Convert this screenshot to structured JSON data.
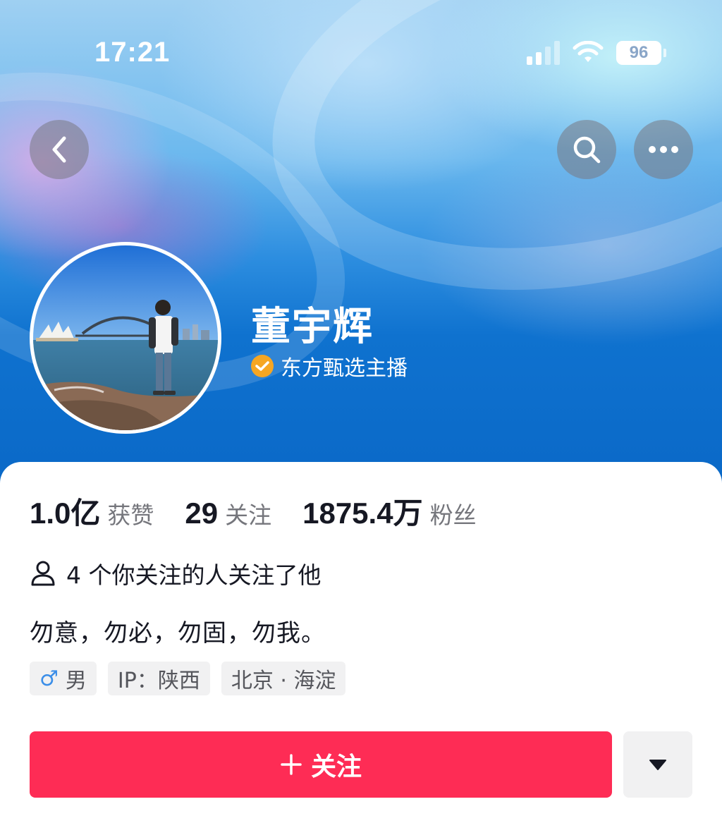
{
  "status_bar": {
    "time": "17:21",
    "battery": "96",
    "icons": [
      "signal-icon",
      "wifi-icon",
      "battery-icon"
    ]
  },
  "nav": {
    "icons": [
      "back-icon",
      "search-icon",
      "more-icon"
    ]
  },
  "profile": {
    "name": "董宇辉",
    "verified_label": "东方甄选主播",
    "verify_color": "#f6a623"
  },
  "stats": [
    {
      "value": "1.0亿",
      "label": "获赞"
    },
    {
      "value": "29",
      "label": "关注"
    },
    {
      "value": "1875.4万",
      "label": "粉丝"
    }
  ],
  "mutual_follow": "4 个你关注的人关注了他",
  "bio": "勿意，勿必，勿固，勿我。",
  "tags": {
    "gender": {
      "symbol": "♂",
      "label": "男"
    },
    "ip": "IP：陕西",
    "location": "北京 · 海淀"
  },
  "actions": {
    "follow_label": "关注",
    "follow_color": "#fe2c55"
  }
}
